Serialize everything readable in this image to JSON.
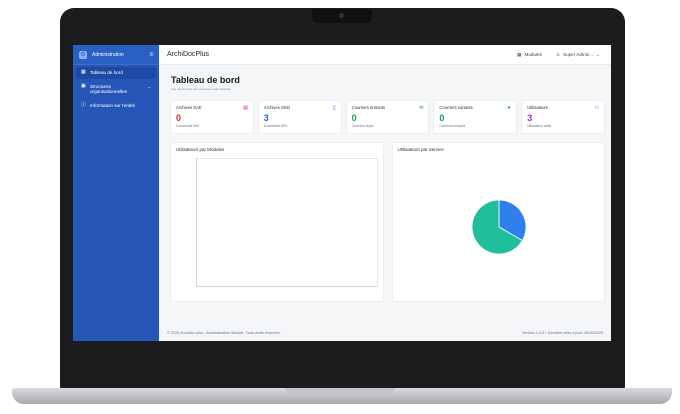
{
  "app": {
    "title": "ArchiDocPlus"
  },
  "sidebar": {
    "header": "Administration",
    "items": [
      {
        "label": "Tableau de bord",
        "icon": "dashboard-icon",
        "active": true
      },
      {
        "label": "Structures organisationnelles",
        "icon": "structure-icon",
        "active": false
      },
      {
        "label": "Information sur l'entité",
        "icon": "info-icon",
        "active": false
      }
    ]
  },
  "topbar": {
    "modules_label": "Modules",
    "user_label": "Super Admin..."
  },
  "page": {
    "title": "Tableau de bord",
    "subtitle": "Vue d'ensemble des processus administratifs"
  },
  "cards": [
    {
      "title": "Archives SAE",
      "value": "0",
      "note": "Documents SAE",
      "color": "#dc2626",
      "icon": "archive-icon"
    },
    {
      "title": "Archives GED",
      "value": "3",
      "note": "Documents GED",
      "color": "#2563eb",
      "icon": "document-icon"
    },
    {
      "title": "Courriers entrants",
      "value": "0",
      "note": "Courriers reçus",
      "color": "#16a34a",
      "icon": "mail-in-icon"
    },
    {
      "title": "Courriers sortants",
      "value": "0",
      "note": "Courriers envoyés",
      "color": "#16a34a",
      "icon": "send-icon"
    },
    {
      "title": "Utilisateurs",
      "value": "3",
      "note": "Utilisateurs actifs",
      "color": "#9333ea",
      "icon": "users-icon"
    }
  ],
  "panels": {
    "modules_title": "Utilisateurs par Modules",
    "service_title": "Utilisateurs par Service"
  },
  "chart_data": [
    {
      "type": "bar",
      "title": "Utilisateurs par Modules",
      "categories": [],
      "values": []
    },
    {
      "type": "pie",
      "title": "Utilisateurs par Service",
      "values": [
        1,
        2
      ],
      "colors": [
        "#2f80ed",
        "#1fbf9c"
      ]
    }
  ],
  "footer": {
    "left": "© 2025 Archidoc.plus - Administration Module. Tous droits réservés.",
    "right": "Version 1.0.0  •  Dernière mise à jour: 25/10/2025"
  }
}
